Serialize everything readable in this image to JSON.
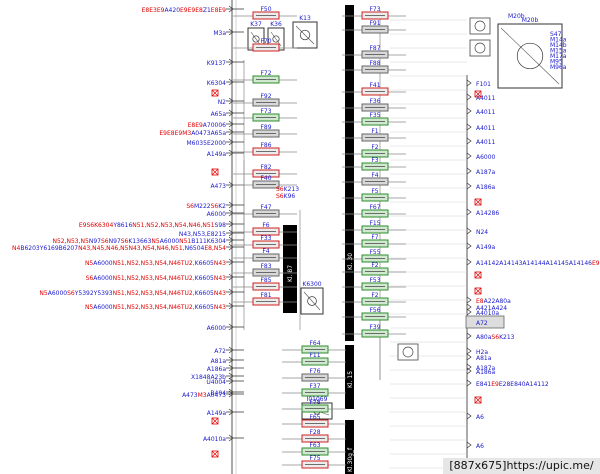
{
  "colors": {
    "blue": "#1a1acc",
    "red": "#e00000",
    "fuse_green_fill": "#cfe8cf",
    "fuse_green_border": "#2e8b2e",
    "fuse_red_fill": "#ececec",
    "fuse_red_border": "#d02020",
    "fuse_gray_fill": "#d8d8d8",
    "fuse_gray_border": "#666666",
    "bus": "#000000",
    "line": "#8a8a8a"
  },
  "footer": {
    "text": "[887x675]https://upic.me/"
  },
  "bus_labels": {
    "kl30": "Kl. 30",
    "kl87": "Kl. 87",
    "kl15": "Kl. 15",
    "kl30g": "Kl.30g_f"
  },
  "relays": [
    {
      "id": "K37",
      "label": "K37"
    },
    {
      "id": "K36",
      "label": "K36"
    },
    {
      "id": "K13",
      "label": "K13"
    },
    {
      "id": "M20b",
      "label": "M20b"
    },
    {
      "id": "K6300",
      "label": "K6300"
    },
    {
      "id": "I01069",
      "label": "I01069"
    }
  ],
  "fuse_labels": [
    "F50",
    "F73",
    "F70",
    "F72",
    "F91",
    "F92",
    "F73",
    "F87",
    "F89",
    "F86",
    "F88",
    "F82",
    "F40",
    "F41",
    "F47",
    "F6",
    "F36",
    "F33",
    "F4",
    "F35",
    "F83",
    "F85",
    "F1",
    "F81",
    "F2",
    "F3",
    "F4",
    "F5",
    "F67",
    "F15",
    "F7",
    "F55",
    "F2",
    "F53",
    "F2",
    "F56",
    "F39",
    "F64",
    "F11",
    "F76",
    "F37",
    "F78",
    "F65",
    "F28",
    "F63",
    "F75",
    "F71",
    "F5",
    "F87",
    "F7",
    "F10",
    "F8",
    "F9",
    "F7",
    "F60",
    "F38",
    "F6",
    "F61"
  ],
  "fuse_kinds": [
    "red",
    "red",
    "red",
    "green",
    "gray",
    "gray",
    "green",
    "gray",
    "gray",
    "red",
    "gray",
    "red",
    "gray",
    "red",
    "gray",
    "red",
    "gray",
    "red",
    "gray",
    "green",
    "gray",
    "red",
    "gray",
    "red",
    "green",
    "green",
    "gray",
    "green",
    "green",
    "green",
    "green",
    "green",
    "green",
    "green",
    "green",
    "green",
    "green",
    "green",
    "green",
    "gray",
    "green",
    "green",
    "red",
    "red",
    "green",
    "red",
    "red",
    "green",
    "green",
    "gray",
    "green",
    "gray",
    "green",
    "red",
    "green",
    "red",
    "green",
    "green"
  ],
  "left_labels": [
    {
      "segs": [
        {
          "t": "E8",
          "c": "red"
        },
        {
          "t": "E3",
          "c": "red"
        },
        {
          "t": "E9",
          "c": "red"
        },
        {
          "t": "A420",
          "c": "blue"
        },
        {
          "t": "E9",
          "c": "red"
        },
        {
          "t": "E9",
          "c": "red"
        },
        {
          "t": "E8",
          "c": "red"
        },
        {
          "t": "Z1",
          "c": "blue"
        },
        {
          "t": "E8",
          "c": "red"
        },
        {
          "t": "E9",
          "c": "red"
        }
      ]
    },
    {
      "segs": [
        {
          "t": "M3a",
          "c": "blue"
        }
      ]
    },
    {
      "segs": [
        {
          "t": "K9137",
          "c": "blue"
        }
      ]
    },
    {
      "segs": [
        {
          "t": "K6304",
          "c": "blue"
        }
      ]
    },
    {
      "segs": [
        {
          "t": "N2",
          "c": "blue"
        }
      ]
    },
    {
      "segs": [
        {
          "t": "A65a",
          "c": "blue"
        }
      ]
    },
    {
      "segs": [
        {
          "t": "E8",
          "c": "red"
        },
        {
          "t": "E9",
          "c": "red"
        },
        {
          "t": "A70006",
          "c": "blue"
        }
      ]
    },
    {
      "segs": [
        {
          "t": "E9",
          "c": "red"
        },
        {
          "t": "E8",
          "c": "red"
        },
        {
          "t": "E9",
          "c": "red"
        },
        {
          "t": "M3",
          "c": "red"
        },
        {
          "t": "A0473",
          "c": "blue"
        },
        {
          "t": "A65a",
          "c": "blue"
        }
      ]
    },
    {
      "segs": [
        {
          "t": "M6035",
          "c": "blue"
        },
        {
          "t": "E2000",
          "c": "blue"
        }
      ]
    },
    {
      "segs": [
        {
          "t": "A149a",
          "c": "blue"
        }
      ]
    },
    {
      "segs": [
        {
          "t": "A473",
          "c": "blue"
        }
      ]
    },
    {
      "segs": [
        {
          "t": "S6",
          "c": "red"
        },
        {
          "t": "M222",
          "c": "blue"
        },
        {
          "t": "S6",
          "c": "red"
        },
        {
          "t": "K2",
          "c": "blue"
        }
      ]
    },
    {
      "segs": [
        {
          "t": "A6000",
          "c": "blue"
        }
      ]
    },
    {
      "segs": [
        {
          "t": "E9",
          "c": "red"
        },
        {
          "t": "S6",
          "c": "red"
        },
        {
          "t": "K6304",
          "c": "red"
        },
        {
          "t": "Y8616",
          "c": "blue"
        },
        {
          "t": "N5",
          "c": "red"
        },
        {
          "t": "1,N52,N53,N54,N46,N51",
          "c": "red"
        },
        {
          "t": "S98",
          "c": "blue"
        }
      ]
    },
    {
      "segs": [
        {
          "t": "N43,N53,E8",
          "c": "blue"
        },
        {
          "t": "215",
          "c": "blue"
        }
      ]
    },
    {
      "segs": [
        {
          "t": "N52,N53,N5",
          "c": "red"
        },
        {
          "t": "N97",
          "c": "blue"
        },
        {
          "t": "S6",
          "c": "red"
        },
        {
          "t": "N97",
          "c": "blue"
        },
        {
          "t": "S6",
          "c": "red"
        },
        {
          "t": "K13663",
          "c": "blue"
        },
        {
          "t": "N5",
          "c": "red"
        },
        {
          "t": "A6000",
          "c": "blue"
        },
        {
          "t": "N51",
          "c": "red"
        },
        {
          "t": "B111K6304",
          "c": "blue"
        }
      ]
    },
    {
      "segs": [
        {
          "t": "N4",
          "c": "red"
        },
        {
          "t": "B6203Y6169",
          "c": "blue"
        },
        {
          "t": "B6207",
          "c": "blue"
        },
        {
          "t": "N43,N45,N46,N5",
          "c": "red"
        },
        {
          "t": "N43,N54,N46,N51,",
          "c": "red"
        },
        {
          "t": "N6504",
          "c": "blue"
        },
        {
          "t": "E8,N54",
          "c": "red"
        }
      ]
    },
    {
      "segs": [
        {
          "t": "N5",
          "c": "red"
        },
        {
          "t": "A6000",
          "c": "blue"
        },
        {
          "t": "N51,N52,N53,N54,N46TU2,",
          "c": "red"
        },
        {
          "t": "K6605",
          "c": "blue"
        },
        {
          "t": "N43",
          "c": "red"
        }
      ]
    },
    {
      "segs": [
        {
          "t": "S6",
          "c": "red"
        },
        {
          "t": "A6000",
          "c": "blue"
        },
        {
          "t": "N51,N52,N53,N54,N46TU2,",
          "c": "red"
        },
        {
          "t": "K6605",
          "c": "blue"
        },
        {
          "t": "N43",
          "c": "red"
        }
      ]
    },
    {
      "segs": [
        {
          "t": "N5",
          "c": "red"
        },
        {
          "t": "A6000",
          "c": "blue"
        },
        {
          "t": "S6",
          "c": "red"
        },
        {
          "t": "Y5392Y5393",
          "c": "blue"
        },
        {
          "t": "N51,N52,N53,N54,N46TU2,",
          "c": "red"
        },
        {
          "t": "K6605",
          "c": "blue"
        },
        {
          "t": "N43",
          "c": "red"
        }
      ]
    },
    {
      "segs": [
        {
          "t": "N5",
          "c": "red"
        },
        {
          "t": "A6000",
          "c": "blue"
        },
        {
          "t": "N51,N52,N53,N54,N46TU2,",
          "c": "red"
        },
        {
          "t": "K6605",
          "c": "blue"
        },
        {
          "t": "N43",
          "c": "red"
        }
      ]
    },
    {
      "segs": [
        {
          "t": "A6000",
          "c": "blue"
        }
      ]
    },
    {
      "segs": [
        {
          "t": "A72",
          "c": "blue"
        }
      ]
    },
    {
      "segs": [
        {
          "t": "A81a",
          "c": "blue"
        }
      ]
    },
    {
      "segs": [
        {
          "t": "A186a",
          "c": "blue"
        }
      ]
    },
    {
      "segs": [
        {
          "t": "X1848",
          "c": "blue"
        },
        {
          "t": "A23b",
          "c": "blue"
        }
      ]
    },
    {
      "segs": [
        {
          "t": "U4004",
          "c": "blue"
        }
      ]
    },
    {
      "segs": [
        {
          "t": "B404",
          "c": "blue"
        }
      ]
    },
    {
      "segs": [
        {
          "t": "A473",
          "c": "blue"
        },
        {
          "t": "M3",
          "c": "red"
        },
        {
          "t": "A0473",
          "c": "blue"
        }
      ]
    },
    {
      "segs": [
        {
          "t": "A149a",
          "c": "blue"
        }
      ]
    },
    {
      "segs": [
        {
          "t": "A4010a",
          "c": "blue"
        }
      ]
    }
  ],
  "right_labels": [
    {
      "segs": [
        {
          "t": "M20b",
          "c": "blue"
        }
      ]
    },
    {
      "segs": [
        {
          "t": "S47",
          "c": "blue"
        },
        {
          "t": "M14a",
          "c": "blue"
        },
        {
          "t": "M14b",
          "c": "blue"
        },
        {
          "t": "M15a",
          "c": "blue"
        },
        {
          "t": "M17a",
          "c": "blue"
        },
        {
          "t": "M95",
          "c": "blue"
        },
        {
          "t": "M96a",
          "c": "blue"
        }
      ]
    },
    {
      "segs": [
        {
          "t": "F101",
          "c": "blue"
        }
      ]
    },
    {
      "segs": [
        {
          "t": "A4011",
          "c": "blue"
        }
      ]
    },
    {
      "segs": [
        {
          "t": "A4011",
          "c": "blue"
        }
      ]
    },
    {
      "segs": [
        {
          "t": "A4011",
          "c": "blue"
        }
      ]
    },
    {
      "segs": [
        {
          "t": "A4011",
          "c": "blue"
        }
      ]
    },
    {
      "segs": [
        {
          "t": "A6000",
          "c": "blue"
        }
      ]
    },
    {
      "segs": [
        {
          "t": "A187a",
          "c": "blue"
        }
      ]
    },
    {
      "segs": [
        {
          "t": "A186a",
          "c": "blue"
        }
      ]
    },
    {
      "segs": [
        {
          "t": "A14286",
          "c": "blue"
        }
      ]
    },
    {
      "segs": [
        {
          "t": "N24",
          "c": "blue"
        }
      ]
    },
    {
      "segs": [
        {
          "t": "A149a",
          "c": "blue"
        }
      ]
    },
    {
      "segs": [
        {
          "t": "A14142",
          "c": "blue"
        },
        {
          "t": "A14143",
          "c": "blue"
        },
        {
          "t": "A14144",
          "c": "blue"
        },
        {
          "t": "A14145",
          "c": "blue"
        },
        {
          "t": "A14146",
          "c": "blue"
        },
        {
          "t": "E9",
          "c": "red"
        },
        {
          "t": "E9",
          "c": "red"
        }
      ]
    },
    {
      "segs": [
        {
          "t": "E8",
          "c": "red"
        },
        {
          "t": "A22",
          "c": "blue"
        },
        {
          "t": "A80a",
          "c": "blue"
        }
      ]
    },
    {
      "segs": [
        {
          "t": "A421A424",
          "c": "blue"
        }
      ]
    },
    {
      "segs": [
        {
          "t": "A4010a",
          "c": "blue"
        }
      ]
    },
    {
      "segs": [
        {
          "t": "A72",
          "c": "blue"
        }
      ]
    },
    {
      "segs": [
        {
          "t": "A80a",
          "c": "blue"
        },
        {
          "t": "S6",
          "c": "red"
        },
        {
          "t": "K213",
          "c": "blue"
        }
      ]
    },
    {
      "segs": [
        {
          "t": "H2a",
          "c": "blue"
        }
      ]
    },
    {
      "segs": [
        {
          "t": "A81a",
          "c": "blue"
        }
      ]
    },
    {
      "segs": [
        {
          "t": "A187a",
          "c": "blue"
        }
      ]
    },
    {
      "segs": [
        {
          "t": "A186a",
          "c": "blue"
        }
      ]
    },
    {
      "segs": [
        {
          "t": "E841",
          "c": "blue"
        },
        {
          "t": "E9",
          "c": "red"
        },
        {
          "t": "E28",
          "c": "blue"
        },
        {
          "t": "E840",
          "c": "blue"
        },
        {
          "t": "A14112",
          "c": "blue"
        }
      ]
    },
    {
      "segs": [
        {
          "t": "A6",
          "c": "blue"
        }
      ]
    },
    {
      "segs": [
        {
          "t": "A6",
          "c": "blue"
        }
      ]
    },
    {
      "segs": [
        {
          "t": "A424",
          "c": "blue"
        },
        {
          "t": "A215",
          "c": "blue"
        },
        {
          "t": "S263",
          "c": "blue"
        },
        {
          "t": "S264",
          "c": "blue"
        },
        {
          "t": "E9",
          "c": "red"
        },
        {
          "t": "x",
          "c": "red"
        }
      ]
    }
  ],
  "mid_labels": [
    {
      "segs": [
        {
          "t": "S6",
          "c": "red"
        },
        {
          "t": "K213",
          "c": "blue"
        }
      ]
    },
    {
      "segs": [
        {
          "t": "S6",
          "c": "red"
        },
        {
          "t": "K96",
          "c": "blue"
        }
      ]
    }
  ]
}
